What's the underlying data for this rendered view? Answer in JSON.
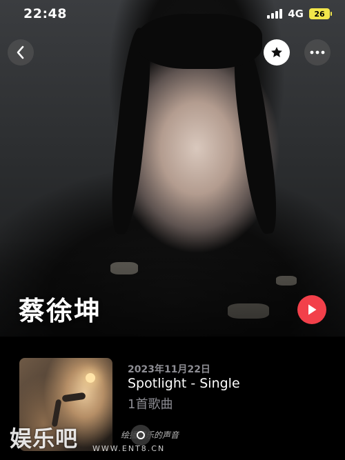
{
  "status_bar": {
    "time": "22:48",
    "network": "4G",
    "battery": "26"
  },
  "nav": {
    "back_icon": "chevron-left-icon",
    "favorite_icon": "star-icon",
    "more_icon": "ellipsis-icon"
  },
  "artist": {
    "name": "蔡徐坤",
    "play_icon": "play-icon",
    "accent_color": "#f2404a"
  },
  "release": {
    "date": "2023年11月22日",
    "title": "Spotlight - Single",
    "track_count": "1首歌曲"
  },
  "watermark": {
    "logo": "娱乐吧",
    "site": "WWW.ENT8.CN",
    "caption": "绘播娱乐的声音"
  }
}
